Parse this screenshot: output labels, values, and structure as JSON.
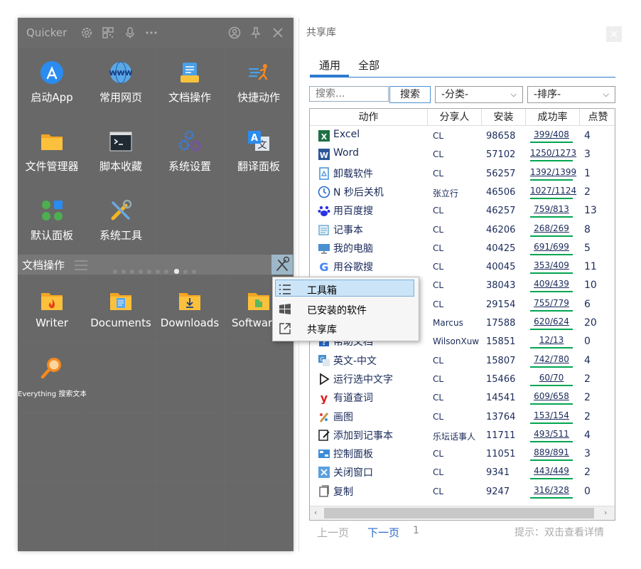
{
  "launcher": {
    "app_title": "Quicker",
    "section_title": "文档操作",
    "tiles": [
      {
        "label": "启动App",
        "icon": "app-store-icon"
      },
      {
        "label": "常用网页",
        "icon": "www-icon"
      },
      {
        "label": "文档操作",
        "icon": "document-icon"
      },
      {
        "label": "快捷动作",
        "icon": "quick-action-icon"
      },
      {
        "label": "文件管理器",
        "icon": "folder-icon"
      },
      {
        "label": "脚本收藏",
        "icon": "terminal-icon"
      },
      {
        "label": "系统设置",
        "icon": "gears-icon"
      },
      {
        "label": "翻译面板",
        "icon": "translate-icon"
      },
      {
        "label": "默认面板",
        "icon": "dots-grid-icon"
      },
      {
        "label": "系统工具",
        "icon": "tools-icon"
      }
    ],
    "doc_tiles": [
      {
        "label": "Writer",
        "icon": "fire-folder-icon"
      },
      {
        "label": "Documents",
        "icon": "documents-folder-icon"
      },
      {
        "label": "Downloads",
        "icon": "downloads-folder-icon"
      },
      {
        "label": "Software",
        "icon": "software-folder-icon"
      },
      {
        "label": "Everything 搜索文本",
        "icon": "magnifier-icon"
      }
    ]
  },
  "context_menu": {
    "items": [
      {
        "label": "工具箱",
        "icon": "list-icon"
      },
      {
        "label": "已安装的软件",
        "icon": "windows-icon"
      },
      {
        "label": "共享库",
        "icon": "external-link-icon"
      }
    ]
  },
  "library": {
    "window_title": "共享库",
    "tabs": [
      "通用",
      "全部"
    ],
    "search_placeholder": "搜索...",
    "search_button": "搜索",
    "category_select": "-分类-",
    "sort_select": "-排序-",
    "columns": [
      "动作",
      "分享人",
      "安装",
      "成功率",
      "点赞"
    ],
    "rows": [
      {
        "name": "Excel",
        "sharer": "CL",
        "installs": "98658",
        "rate": "399/408",
        "likes": "4",
        "icon": "excel-icon",
        "color": "#1e7145"
      },
      {
        "name": "Word",
        "sharer": "CL",
        "installs": "57102",
        "rate": "1250/1273",
        "likes": "3",
        "icon": "word-icon",
        "color": "#2b579a"
      },
      {
        "name": "卸载软件",
        "sharer": "CL",
        "installs": "56257",
        "rate": "1392/1399",
        "likes": "1",
        "icon": "recycle-icon",
        "color": "#3c8dd8"
      },
      {
        "name": "N 秒后关机",
        "sharer": "张立行",
        "installs": "46506",
        "rate": "1027/1124",
        "likes": "2",
        "icon": "clock-icon",
        "color": "#2a6ac8"
      },
      {
        "name": "用百度搜",
        "sharer": "CL",
        "installs": "46257",
        "rate": "759/813",
        "likes": "13",
        "icon": "baidu-icon",
        "color": "#2932e1"
      },
      {
        "name": "记事本",
        "sharer": "CL",
        "installs": "46206",
        "rate": "268/269",
        "likes": "8",
        "icon": "notepad-icon",
        "color": "#5aa0c8"
      },
      {
        "name": "我的电脑",
        "sharer": "CL",
        "installs": "40425",
        "rate": "691/699",
        "likes": "5",
        "icon": "computer-icon",
        "color": "#4a90d0"
      },
      {
        "name": "用谷歌搜",
        "sharer": "CL",
        "installs": "40045",
        "rate": "353/409",
        "likes": "11",
        "icon": "google-icon",
        "color": "#4285f4"
      },
      {
        "name": "",
        "sharer": "CL",
        "installs": "38043",
        "rate": "409/439",
        "likes": "10",
        "icon": "",
        "color": "#888888"
      },
      {
        "name": "",
        "sharer": "CL",
        "installs": "29154",
        "rate": "755/779",
        "likes": "6",
        "icon": "",
        "color": "#888888"
      },
      {
        "name": "",
        "sharer": "Marcus",
        "installs": "17588",
        "rate": "620/624",
        "likes": "20",
        "icon": "",
        "color": "#888888"
      },
      {
        "name": "帮助文档",
        "sharer": "WilsonXuw",
        "installs": "15851",
        "rate": "12/13",
        "likes": "0",
        "icon": "help-icon",
        "color": "#2a6ac8"
      },
      {
        "name": "英文-中文",
        "sharer": "CL",
        "installs": "15807",
        "rate": "742/780",
        "likes": "4",
        "icon": "translate-small-icon",
        "color": "#4a90d0"
      },
      {
        "name": "运行选中文字",
        "sharer": "CL",
        "installs": "15466",
        "rate": "60/70",
        "likes": "2",
        "icon": "play-icon",
        "color": "#222222"
      },
      {
        "name": "有道查词",
        "sharer": "CL",
        "installs": "14541",
        "rate": "609/658",
        "likes": "2",
        "icon": "youdao-icon",
        "color": "#e02020"
      },
      {
        "name": "画图",
        "sharer": "CL",
        "installs": "13764",
        "rate": "153/154",
        "likes": "2",
        "icon": "paint-icon",
        "color": "#c89040"
      },
      {
        "name": "添加到记事本",
        "sharer": "乐坛话事人",
        "installs": "11711",
        "rate": "493/511",
        "likes": "4",
        "icon": "edit-note-icon",
        "color": "#222222"
      },
      {
        "name": "控制面板",
        "sharer": "CL",
        "installs": "11051",
        "rate": "889/891",
        "likes": "3",
        "icon": "control-panel-icon",
        "color": "#3c8dd8"
      },
      {
        "name": "关闭窗口",
        "sharer": "CL",
        "installs": "9341",
        "rate": "443/449",
        "likes": "2",
        "icon": "close-window-icon",
        "color": "#5aa0e0"
      },
      {
        "name": "复制",
        "sharer": "CL",
        "installs": "9247",
        "rate": "316/328",
        "likes": "0",
        "icon": "copy-icon",
        "color": "#555555"
      }
    ],
    "prev_page": "上一页",
    "next_page": "下一页",
    "page_number": "1",
    "hint": "提示：双击查看详情"
  }
}
